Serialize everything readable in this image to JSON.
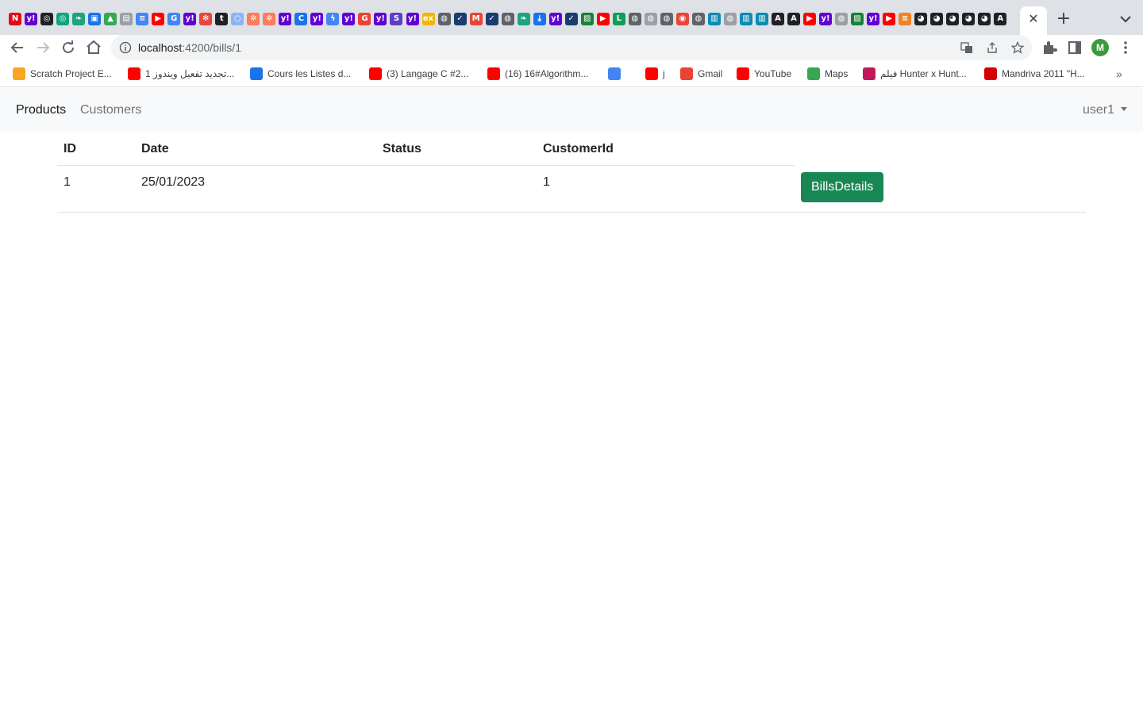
{
  "browser": {
    "tab_icons": [
      {
        "name": "netflix-icon",
        "color": "#e50914",
        "glyph": "N"
      },
      {
        "name": "yahoo-icon",
        "color": "#6001d2",
        "glyph": "y!"
      },
      {
        "name": "openai-icon",
        "color": "#202124",
        "glyph": "◎"
      },
      {
        "name": "openai-icon",
        "color": "#10a37f",
        "glyph": "◎"
      },
      {
        "name": "leaf-icon",
        "color": "#1fa37f",
        "glyph": "❧"
      },
      {
        "name": "contacts-icon",
        "color": "#1a73e8",
        "glyph": "▣"
      },
      {
        "name": "drive-icon",
        "color": "#34a853",
        "glyph": "▲"
      },
      {
        "name": "document-icon",
        "color": "#9aa0a6",
        "glyph": "▤"
      },
      {
        "name": "docs-icon",
        "color": "#4285f4",
        "glyph": "≡"
      },
      {
        "name": "youtube-icon",
        "color": "#ff0000",
        "glyph": "▶"
      },
      {
        "name": "translate-icon",
        "color": "#4285f4",
        "glyph": "G"
      },
      {
        "name": "yahoo-icon",
        "color": "#6001d2",
        "glyph": "y!"
      },
      {
        "name": "butterfly-icon",
        "color": "#e8453c",
        "glyph": "✻"
      },
      {
        "name": "tumblr-icon",
        "color": "#202124",
        "glyph": "t"
      },
      {
        "name": "circle-icon",
        "color": "#8ab4f8",
        "glyph": "○"
      },
      {
        "name": "hubspot-icon",
        "color": "#ff7a59",
        "glyph": "✲"
      },
      {
        "name": "hubspot-icon",
        "color": "#ff7a59",
        "glyph": "✲"
      },
      {
        "name": "yahoo-icon",
        "color": "#6001d2",
        "glyph": "y!"
      },
      {
        "name": "c-icon",
        "color": "#1a73e8",
        "glyph": "C"
      },
      {
        "name": "yahoo-icon",
        "color": "#6001d2",
        "glyph": "y!"
      },
      {
        "name": "bolt-icon",
        "color": "#4285f4",
        "glyph": "ϟ"
      },
      {
        "name": "yahoo-icon",
        "color": "#6001d2",
        "glyph": "y!"
      },
      {
        "name": "g-icon",
        "color": "#ea4335",
        "glyph": "G"
      },
      {
        "name": "yahoo-icon",
        "color": "#6001d2",
        "glyph": "y!"
      },
      {
        "name": "s-icon",
        "color": "#5f3dc4",
        "glyph": "S"
      },
      {
        "name": "yahoo-icon",
        "color": "#6001d2",
        "glyph": "y!"
      },
      {
        "name": "ex-icon",
        "color": "#f4b400",
        "glyph": "ex"
      },
      {
        "name": "globe-icon",
        "color": "#5f6368",
        "glyph": "◍"
      },
      {
        "name": "check-icon",
        "color": "#1a3c6e",
        "glyph": "✓"
      },
      {
        "name": "gmail-icon",
        "color": "#ea4335",
        "glyph": "M"
      },
      {
        "name": "check-icon",
        "color": "#1a3c6e",
        "glyph": "✓"
      },
      {
        "name": "globe-icon",
        "color": "#5f6368",
        "glyph": "◍"
      },
      {
        "name": "leaf-icon",
        "color": "#1fa37f",
        "glyph": "❧"
      },
      {
        "name": "download-icon",
        "color": "#1a73e8",
        "glyph": "⤓"
      },
      {
        "name": "yahoo-icon",
        "color": "#6001d2",
        "glyph": "y!"
      },
      {
        "name": "check-icon",
        "color": "#1a3c6e",
        "glyph": "✓"
      },
      {
        "name": "image-icon",
        "color": "#188038",
        "glyph": "▨"
      },
      {
        "name": "youtube-icon",
        "color": "#ff0000",
        "glyph": "▶"
      },
      {
        "name": "l-icon",
        "color": "#0f9d58",
        "glyph": "L"
      },
      {
        "name": "globe-icon",
        "color": "#5f6368",
        "glyph": "◍"
      },
      {
        "name": "globe-icon",
        "color": "#9aa0a6",
        "glyph": "◍"
      },
      {
        "name": "globe-icon",
        "color": "#5f6368",
        "glyph": "◍"
      },
      {
        "name": "chrome-icon",
        "color": "#ea4335",
        "glyph": "◉"
      },
      {
        "name": "globe-icon",
        "color": "#5f6368",
        "glyph": "◍"
      },
      {
        "name": "app-icon",
        "color": "#0b8bb5",
        "glyph": "▥"
      },
      {
        "name": "globe-icon",
        "color": "#9aa0a6",
        "glyph": "◍"
      },
      {
        "name": "app-icon",
        "color": "#0b8bb5",
        "glyph": "▥"
      },
      {
        "name": "app-icon",
        "color": "#0b8bb5",
        "glyph": "▥"
      },
      {
        "name": "angular-icon",
        "color": "#202124",
        "glyph": "A"
      },
      {
        "name": "angular-icon",
        "color": "#202124",
        "glyph": "A"
      },
      {
        "name": "youtube-icon",
        "color": "#ff0000",
        "glyph": "▶"
      },
      {
        "name": "yahoo-icon",
        "color": "#6001d2",
        "glyph": "y!"
      },
      {
        "name": "globe-icon",
        "color": "#9aa0a6",
        "glyph": "◍"
      },
      {
        "name": "image-icon",
        "color": "#188038",
        "glyph": "▨"
      },
      {
        "name": "yahoo-icon",
        "color": "#6001d2",
        "glyph": "y!"
      },
      {
        "name": "youtube-icon",
        "color": "#ff0000",
        "glyph": "▶"
      },
      {
        "name": "stackoverflow-icon",
        "color": "#f48024",
        "glyph": "≡"
      },
      {
        "name": "github-icon",
        "color": "#202124",
        "glyph": "◕"
      },
      {
        "name": "github-icon",
        "color": "#202124",
        "glyph": "◕"
      },
      {
        "name": "github-icon",
        "color": "#202124",
        "glyph": "◕"
      },
      {
        "name": "github-icon",
        "color": "#202124",
        "glyph": "◕"
      },
      {
        "name": "github-icon",
        "color": "#202124",
        "glyph": "◕"
      },
      {
        "name": "angular-icon",
        "color": "#202124",
        "glyph": "A"
      }
    ],
    "tab_close": "✕",
    "new_tab": "+",
    "url_host": "localhost",
    "url_rest": ":4200/bills/1",
    "profile_initial": "M",
    "bookmarks": [
      {
        "label": "Scratch Project E...",
        "icon": "scratch-icon",
        "color": "#f6a623"
      },
      {
        "label": "تجديد تفعيل ويندوز 1...",
        "icon": "youtube-icon",
        "color": "#ff0000"
      },
      {
        "label": "Cours les Listes d...",
        "icon": "course-icon",
        "color": "#1a73e8"
      },
      {
        "label": "(3) Langage C #2...",
        "icon": "youtube-icon",
        "color": "#ff0000"
      },
      {
        "label": "(16) 16#Algorithm...",
        "icon": "youtube-icon",
        "color": "#ff0000"
      },
      {
        "label": "",
        "icon": "network-icon",
        "color": "#4285f4"
      },
      {
        "label": "j",
        "icon": "youtube-icon",
        "color": "#ff0000"
      },
      {
        "label": "Gmail",
        "icon": "gmail-icon",
        "color": "#ea4335"
      },
      {
        "label": "YouTube",
        "icon": "youtube-icon",
        "color": "#ff0000"
      },
      {
        "label": "Maps",
        "icon": "maps-icon",
        "color": "#34a853"
      },
      {
        "label": "فيلم Hunter x Hunt...",
        "icon": "movie-icon",
        "color": "#c2185b"
      },
      {
        "label": "Mandriva 2011 \"H...",
        "icon": "mandriva-icon",
        "color": "#d50000"
      }
    ],
    "bookmarks_overflow": "»"
  },
  "navbar": {
    "products": "Products",
    "customers": "Customers",
    "user": "user1"
  },
  "table": {
    "headers": [
      "ID",
      "Date",
      "Status",
      "CustomerId"
    ],
    "rows": [
      {
        "id": "1",
        "date": "25/01/2023",
        "status": "",
        "customer_id": "1",
        "action": "BillsDetails"
      }
    ]
  },
  "colors": {
    "success": "#198754",
    "navbar_bg": "#f8f9fa"
  }
}
